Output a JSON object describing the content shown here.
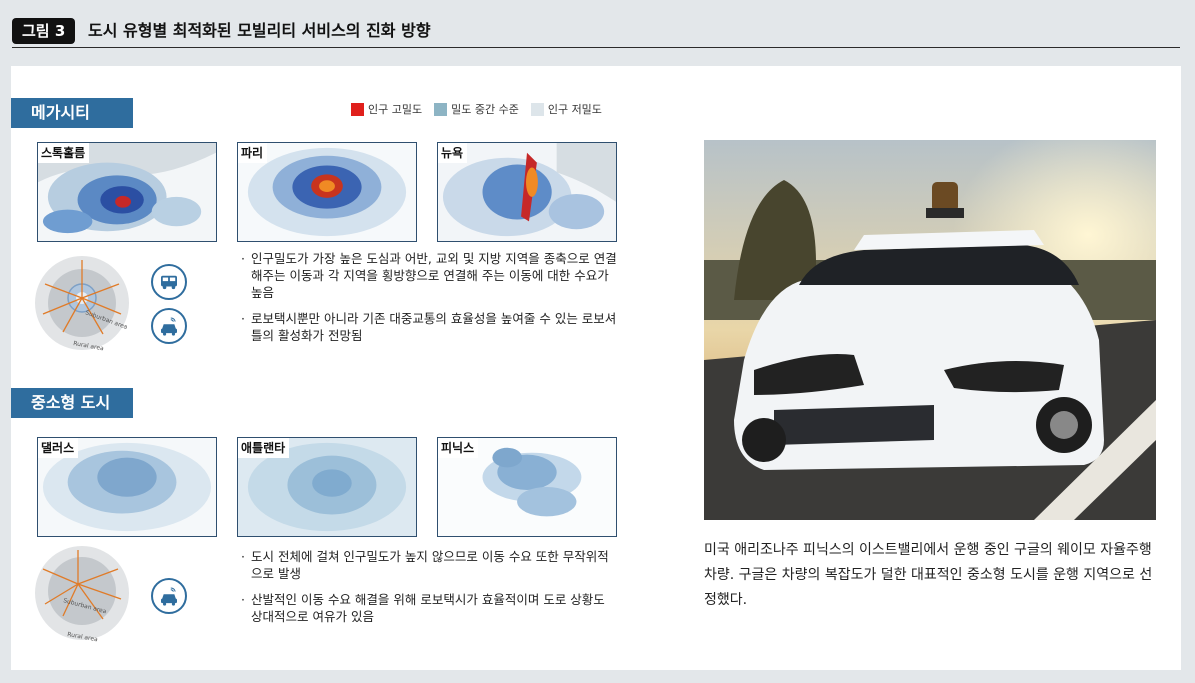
{
  "figure": {
    "badge": "그림 3",
    "title": "도시 유형별 최적화된 모빌리티 서비스의 진화 방향"
  },
  "legend": [
    {
      "label": "인구 고밀도",
      "color": "#e0201c"
    },
    {
      "label": "밀도 중간 수준",
      "color": "#8db4c4"
    },
    {
      "label": "인구 저밀도",
      "color": "#dde5ea"
    }
  ],
  "megacity": {
    "label": "메가시티",
    "maps": [
      "스톡홀름",
      "파리",
      "뉴욕"
    ],
    "diagram": {
      "inner": "Suburban area",
      "outer": "Rural area"
    },
    "icons": [
      "bus-icon",
      "robotaxi-icon"
    ],
    "bullets": [
      "인구밀도가 가장 높은 도심과 어반, 교외 및 지방 지역을 종축으로 연결해주는 이동과 각 지역을 횡방향으로 연결해 주는 이동에 대한 수요가 높음",
      "로보택시뿐만 아니라 기존 대중교통의 효율성을 높여줄 수 있는 로보셔틀의 활성화가 전망됨"
    ]
  },
  "smallcity": {
    "label": "중소형 도시",
    "maps": [
      "댈러스",
      "애틀랜타",
      "피닉스"
    ],
    "diagram": {
      "inner": "Suburban area",
      "outer": "Rural area"
    },
    "icons": [
      "robotaxi-icon"
    ],
    "bullets": [
      "도시 전체에 걸쳐 인구밀도가 높지 않으므로 이동 수요 또한 무작위적으로 발생",
      "산발적인 이동 수요 해결을 위해 로보택시가 효율적이며 도로 상황도 상대적으로 여유가 있음"
    ]
  },
  "photo": {
    "caption": "미국 애리조나주 피닉스의 이스트밸리에서 운행 중인 구글의 웨이모 자율주행 차량. 구글은 차량의 복잡도가 덜한 대표적인 중소형 도시를 운행 지역으로 선정했다."
  }
}
